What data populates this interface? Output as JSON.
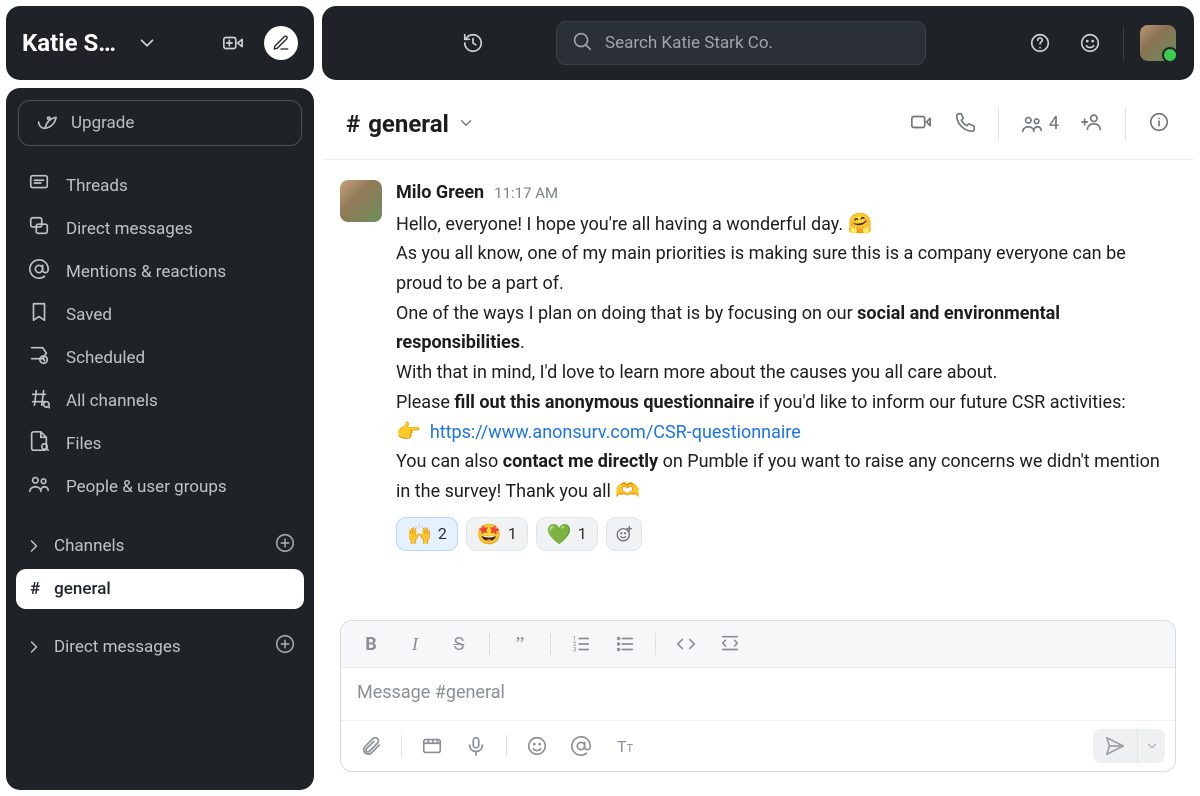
{
  "workspace": {
    "name": "Katie S…"
  },
  "search": {
    "placeholder": "Search Katie Stark Co."
  },
  "sidebar": {
    "upgrade": "Upgrade",
    "nav": {
      "threads": "Threads",
      "dms": "Direct messages",
      "mentions": "Mentions & reactions",
      "saved": "Saved",
      "scheduled": "Scheduled",
      "all_channels": "All channels",
      "files": "Files",
      "people": "People & user groups"
    },
    "sections": {
      "channels": "Channels",
      "dms": "Direct messages"
    },
    "active_channel": {
      "name": "general",
      "prefix": "#"
    }
  },
  "channel_header": {
    "prefix": "#",
    "name": "general",
    "member_count": "4"
  },
  "message": {
    "author": "Milo Green",
    "time": "11:17 AM",
    "p1_a": "Hello, everyone! I hope you're all having a wonderful day. ",
    "p1_emoji": "🤗",
    "p2": "As you all know, one of my main priorities is making sure this is a company everyone can be proud to be a part of.",
    "p3_a": "One of the ways I plan on doing that is by focusing on our ",
    "p3_b": "social and environmental responsibilities",
    "p3_c": ".",
    "p4": "With that in mind, I'd love to learn more about the causes you all care about.",
    "p5_a": "Please ",
    "p5_b": "fill out this anonymous questionnaire",
    "p5_c": " if you'd like to inform our future CSR activities:",
    "p6_emoji": "👉",
    "p6_link": "https://www.anonsurv.com/CSR-questionnaire",
    "p7_a": "You can also ",
    "p7_b": "contact me directly",
    "p7_c": " on Pumble if you want to raise any concerns we didn't mention in the survey! Thank you all ",
    "p7_emoji": "🫶",
    "reactions": [
      {
        "emoji": "🙌",
        "count": "2",
        "selected": true
      },
      {
        "emoji": "🤩",
        "count": "1",
        "selected": false
      },
      {
        "emoji": "💚",
        "count": "1",
        "selected": false
      }
    ]
  },
  "composer": {
    "placeholder": "Message #general"
  }
}
